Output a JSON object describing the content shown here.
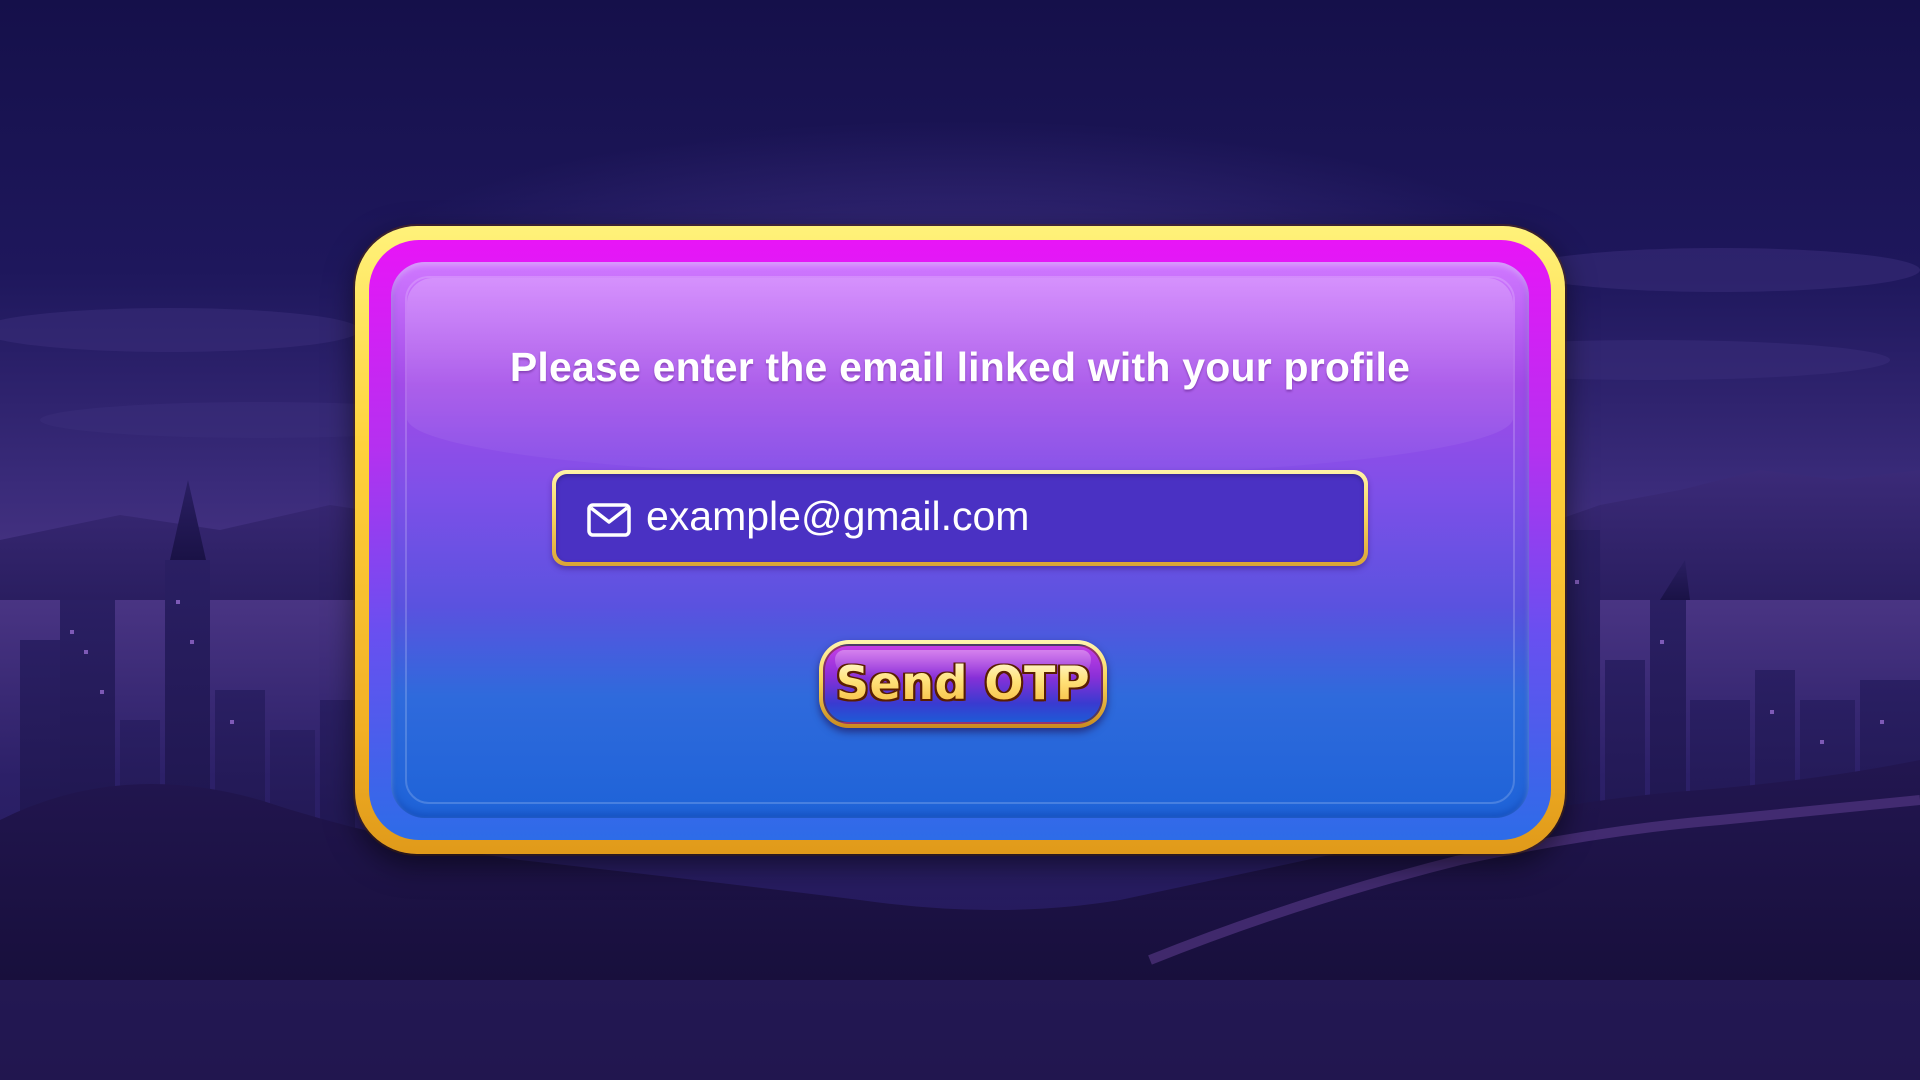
{
  "dialog": {
    "prompt": "Please enter the email linked with your profile",
    "email_field": {
      "icon": "mail-icon",
      "value": "example@gmail.com"
    },
    "send_button": {
      "label": "Send OTP"
    }
  },
  "colors": {
    "frame_gold": "#ffd23c",
    "panel_top": "#d078ff",
    "panel_bottom": "#1e63d8",
    "field_fill": "#4a31c3",
    "button_text": "#ffe27a"
  }
}
